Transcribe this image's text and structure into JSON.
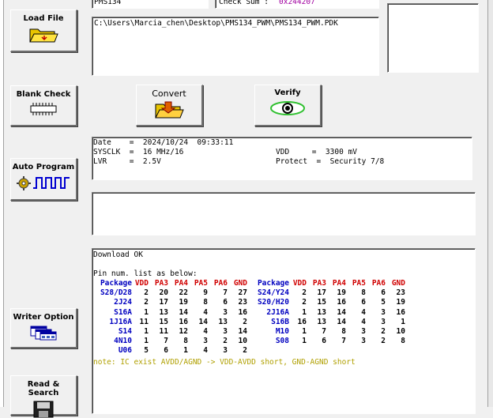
{
  "top": {
    "chip_name": "PMS134",
    "checksum_text": "Check Sum : ",
    "checksum_value": "0x244207"
  },
  "file_path": "C:\\Users\\Marcia_chen\\Desktop\\PMS134_PWM\\PMS134_PWM.PDK",
  "sidebar": {
    "load_file": "Load File",
    "blank_check": "Blank Check",
    "auto_program": "Auto Program",
    "writer_option": "Writer Option",
    "read_search": "Read & Search"
  },
  "actions": {
    "convert": "Convert",
    "verify": "Verify"
  },
  "info": {
    "date_line": "Date    =  2024/10/24  09:33:11",
    "sysclk_line": "SYSCLK  =  16 MHz/16",
    "lvr_line": "LVR     =  2.5V",
    "vdd_line": "VDD     =  3300 mV",
    "protect_line": "Protect  =  Security 7/8"
  },
  "log": {
    "status": "Download OK",
    "pin_title": "Pin num. list as below:",
    "headers": [
      "Package",
      "VDD",
      "PA3",
      "PA4",
      "PA5",
      "PA6",
      "GND"
    ],
    "left_rows": [
      [
        "S28/D28",
        "2",
        "20",
        "22",
        "9",
        "7",
        "27"
      ],
      [
        "2J24",
        "2",
        "17",
        "19",
        "8",
        "6",
        "23"
      ],
      [
        "S16A",
        "1",
        "13",
        "14",
        "4",
        "3",
        "16"
      ],
      [
        "1J16A",
        "11",
        "15",
        "16",
        "14",
        "13",
        "2"
      ],
      [
        "S14",
        "1",
        "11",
        "12",
        "4",
        "3",
        "14"
      ],
      [
        "4N10",
        "1",
        "7",
        "8",
        "3",
        "2",
        "10"
      ],
      [
        "U06",
        "5",
        "6",
        "1",
        "4",
        "3",
        "2"
      ]
    ],
    "right_rows": [
      [
        "S24/Y24",
        "2",
        "17",
        "19",
        "8",
        "6",
        "23"
      ],
      [
        "S20/H20",
        "2",
        "15",
        "16",
        "6",
        "5",
        "19"
      ],
      [
        "2J16A",
        "1",
        "13",
        "14",
        "4",
        "3",
        "16"
      ],
      [
        "S16B",
        "16",
        "13",
        "14",
        "4",
        "3",
        "1"
      ],
      [
        "M10",
        "1",
        "7",
        "8",
        "3",
        "2",
        "10"
      ],
      [
        "S08",
        "1",
        "6",
        "7",
        "3",
        "2",
        "8"
      ]
    ],
    "note": "note: IC exist AVDD/AGND -> VDD-AVDD short, GND-AGND short"
  },
  "colors": {
    "header_blue": "#0000c0",
    "header_red": "#d00000",
    "note": "#b0a000",
    "checksum": "#a000a0"
  },
  "icons": [
    "folder-icon",
    "chip-icon",
    "gear-icon",
    "pulse-wave-icon",
    "folder-convert-icon",
    "eye-icon",
    "window-stack-icon",
    "save-disk-icon"
  ]
}
